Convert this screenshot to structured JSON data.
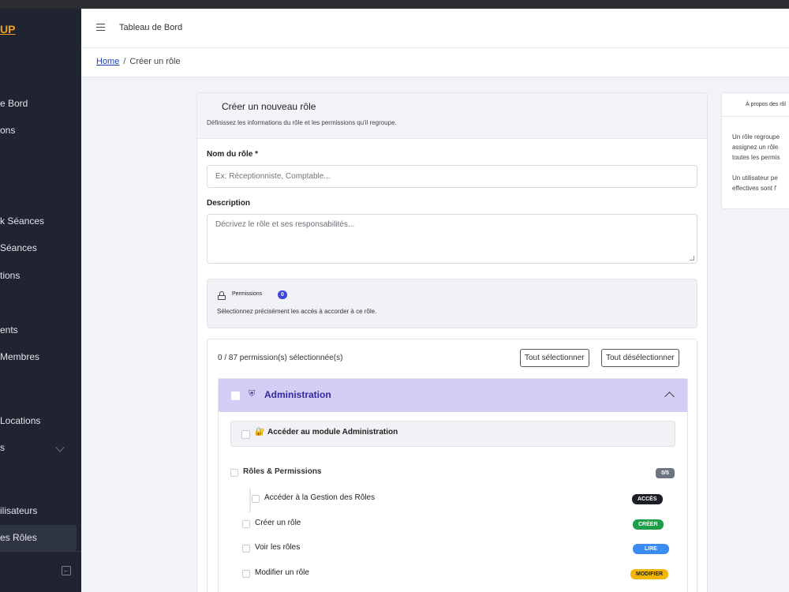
{
  "sidebar": {
    "logo": "UP",
    "items": [
      {
        "label": "e Bord"
      },
      {
        "label": "ons"
      },
      {
        "label": "k Séances"
      },
      {
        "label": "Séances"
      },
      {
        "label": "tions"
      },
      {
        "label": "ents"
      },
      {
        "label": "Membres"
      },
      {
        "label": "Locations"
      },
      {
        "label": "s"
      },
      {
        "label": "ilisateurs"
      },
      {
        "label": "es Rôles"
      }
    ]
  },
  "header": {
    "title": "Tableau de Bord"
  },
  "breadcrumb": {
    "home": "Home",
    "current": "Créer un rôle"
  },
  "form": {
    "title": "Créer un nouveau rôle",
    "subtitle": "Définissez les informations du rôle et les permissions qu'il regroupe.",
    "name_label": "Nom du rôle *",
    "name_placeholder": "Ex: Réceptionniste, Comptable...",
    "desc_label": "Description",
    "desc_placeholder": "Décrivez le rôle et ses responsabilités..."
  },
  "permissions": {
    "title": "Permissions",
    "count": "0",
    "subtitle": "Sélectionnez précisément les accès à accorder à ce rôle.",
    "selected_text": "0 / 87 permission(s) sélectionnée(s)",
    "select_all": "Tout sélectionner",
    "deselect_all": "Tout désélectionner"
  },
  "module": {
    "title": "Administration",
    "access_label": "Accéder au module Administration",
    "group": {
      "title": "Rôles & Permissions",
      "badge": "0/5"
    },
    "perms": [
      {
        "label": "Accéder à la Gestion des Rôles",
        "tag": "ACCÈS",
        "tag_color": "#1c1f26"
      },
      {
        "label": "Créer un rôle",
        "tag": "CRÉER",
        "tag_color": "#1e9e48"
      },
      {
        "label": "Voir les rôles",
        "tag": "LIRE",
        "tag_color": "#3b8cf0"
      },
      {
        "label": "Modifier un rôle",
        "tag": "MODIFIER",
        "tag_color": "#f2b705"
      }
    ]
  },
  "about": {
    "title": "À propos des rôl",
    "lines1": [
      "Un rôle regroupe",
      "assignez un rôle",
      "toutes les permis"
    ],
    "lines2": [
      "Un utilisateur pe",
      "effectives sont l'"
    ]
  }
}
